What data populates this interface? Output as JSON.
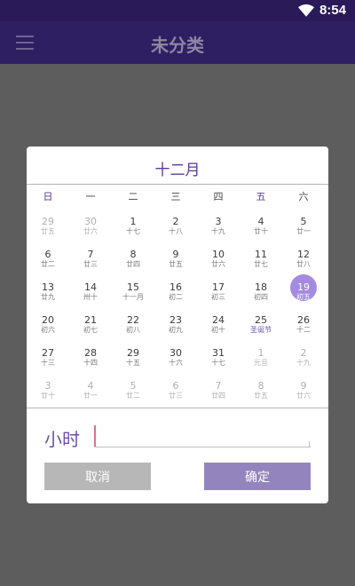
{
  "status": {
    "time": "8:54"
  },
  "app": {
    "title": "未分类"
  },
  "picker": {
    "month": "十二月",
    "weekdays": [
      "日",
      "一",
      "二",
      "三",
      "四",
      "五",
      "六"
    ],
    "weeks": [
      [
        {
          "d": "29",
          "l": "廿五",
          "o": true
        },
        {
          "d": "30",
          "l": "廿六",
          "o": true
        },
        {
          "d": "1",
          "l": "十七"
        },
        {
          "d": "2",
          "l": "十八"
        },
        {
          "d": "3",
          "l": "十九"
        },
        {
          "d": "4",
          "l": "廿十"
        },
        {
          "d": "5",
          "l": "廿一"
        }
      ],
      [
        {
          "d": "6",
          "l": "廿二"
        },
        {
          "d": "7",
          "l": "廿三"
        },
        {
          "d": "8",
          "l": "廿四"
        },
        {
          "d": "9",
          "l": "廿五"
        },
        {
          "d": "10",
          "l": "廿六"
        },
        {
          "d": "11",
          "l": "廿七"
        },
        {
          "d": "12",
          "l": "廿八"
        }
      ],
      [
        {
          "d": "13",
          "l": "廿九"
        },
        {
          "d": "14",
          "l": "卅十"
        },
        {
          "d": "15",
          "l": "十一月"
        },
        {
          "d": "16",
          "l": "初二"
        },
        {
          "d": "17",
          "l": "初三"
        },
        {
          "d": "18",
          "l": "初四"
        },
        {
          "d": "19",
          "l": "初五",
          "s": true
        }
      ],
      [
        {
          "d": "20",
          "l": "初六"
        },
        {
          "d": "21",
          "l": "初七"
        },
        {
          "d": "22",
          "l": "初八"
        },
        {
          "d": "23",
          "l": "初九"
        },
        {
          "d": "24",
          "l": "初十"
        },
        {
          "d": "25",
          "l": "圣诞节",
          "f": true
        },
        {
          "d": "26",
          "l": "十二"
        }
      ],
      [
        {
          "d": "27",
          "l": "十三"
        },
        {
          "d": "28",
          "l": "十四"
        },
        {
          "d": "29",
          "l": "十五"
        },
        {
          "d": "30",
          "l": "十六"
        },
        {
          "d": "31",
          "l": "十七"
        },
        {
          "d": "1",
          "l": "元旦",
          "o": true
        },
        {
          "d": "2",
          "l": "十九",
          "o": true
        }
      ],
      [
        {
          "d": "3",
          "l": "廿十",
          "o": true
        },
        {
          "d": "4",
          "l": "廿一",
          "o": true
        },
        {
          "d": "5",
          "l": "廿二",
          "o": true
        },
        {
          "d": "6",
          "l": "廿三",
          "o": true
        },
        {
          "d": "7",
          "l": "廿四",
          "o": true
        },
        {
          "d": "8",
          "l": "廿五",
          "o": true
        },
        {
          "d": "9",
          "l": "廿六",
          "o": true
        }
      ]
    ]
  },
  "hour": {
    "label": "小时",
    "value": ""
  },
  "buttons": {
    "cancel": "取消",
    "ok": "确定"
  },
  "colors": {
    "app_bar": "#2d1f62",
    "accent": "#a48ae0",
    "weekday_header": "#5b3a94"
  }
}
